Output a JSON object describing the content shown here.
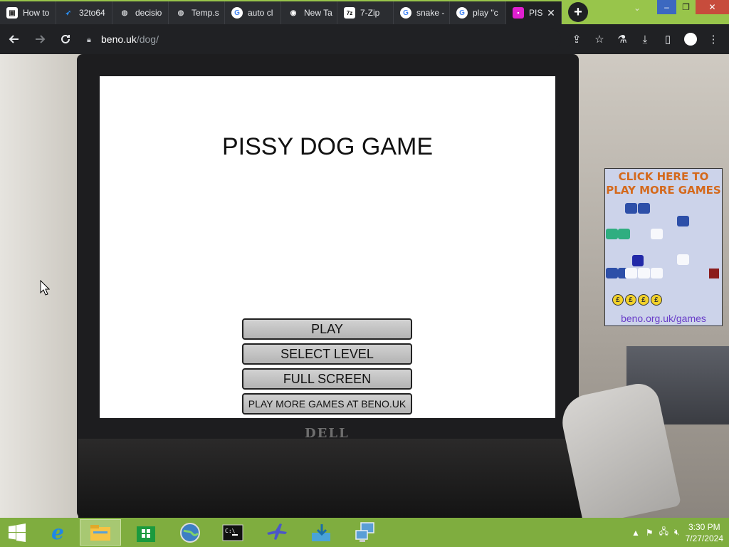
{
  "browser": {
    "tabs": [
      {
        "title": "How to",
        "favicon": "page-icon",
        "color": "#ffffff"
      },
      {
        "title": "32to64",
        "favicon": "blue-swirl-icon",
        "color": "#2a8df0"
      },
      {
        "title": "decisio",
        "favicon": "globe-icon",
        "color": "#c7c9cc"
      },
      {
        "title": "Temp.s",
        "favicon": "globe-icon",
        "color": "#c7c9cc"
      },
      {
        "title": "auto cl",
        "favicon": "google-icon",
        "color": "#ffffff"
      },
      {
        "title": "New Ta",
        "favicon": "chrome-icon",
        "color": "#ffffff"
      },
      {
        "title": "7-Zip",
        "favicon": "7zip-icon",
        "color": "#ffffff"
      },
      {
        "title": "snake -",
        "favicon": "google-icon",
        "color": "#ffffff"
      },
      {
        "title": "play \"c",
        "favicon": "google-icon",
        "color": "#ffffff"
      },
      {
        "title": "PIS",
        "favicon": "pissy-dog-icon",
        "color": "#e020d0"
      }
    ],
    "new_tab_symbol": "+",
    "url_host": "beno.uk",
    "url_path": "/dog/",
    "window_controls": {
      "minimize": "–",
      "maximize": "❐",
      "close": "✕"
    }
  },
  "game": {
    "title": "PISSY DOG GAME",
    "buttons": [
      {
        "label": "PLAY"
      },
      {
        "label": "SELECT LEVEL"
      },
      {
        "label": "FULL SCREEN"
      },
      {
        "label": "PLAY MORE GAMES AT BENO.UK"
      }
    ]
  },
  "ad": {
    "headline_line1": "CLICK HERE TO",
    "headline_line2": "PLAY MORE GAMES",
    "url": "beno.org.uk/games",
    "coin_symbol": "£"
  },
  "background": {
    "laptop_brand": "DELL"
  },
  "taskbar": {
    "apps": [
      {
        "name": "internet-explorer-icon"
      },
      {
        "name": "file-explorer-icon"
      },
      {
        "name": "store-icon"
      },
      {
        "name": "globe-app-icon"
      },
      {
        "name": "command-prompt-icon"
      },
      {
        "name": "airplane-app-icon"
      },
      {
        "name": "install-app-icon"
      },
      {
        "name": "network-app-icon"
      }
    ],
    "time": "3:30 PM",
    "date": "7/27/2024"
  },
  "colors": {
    "tab_strip": "#98c54b",
    "taskbar": "#7fad3f",
    "ad_headline": "#d4691c",
    "ad_url": "#6a3fc9"
  }
}
